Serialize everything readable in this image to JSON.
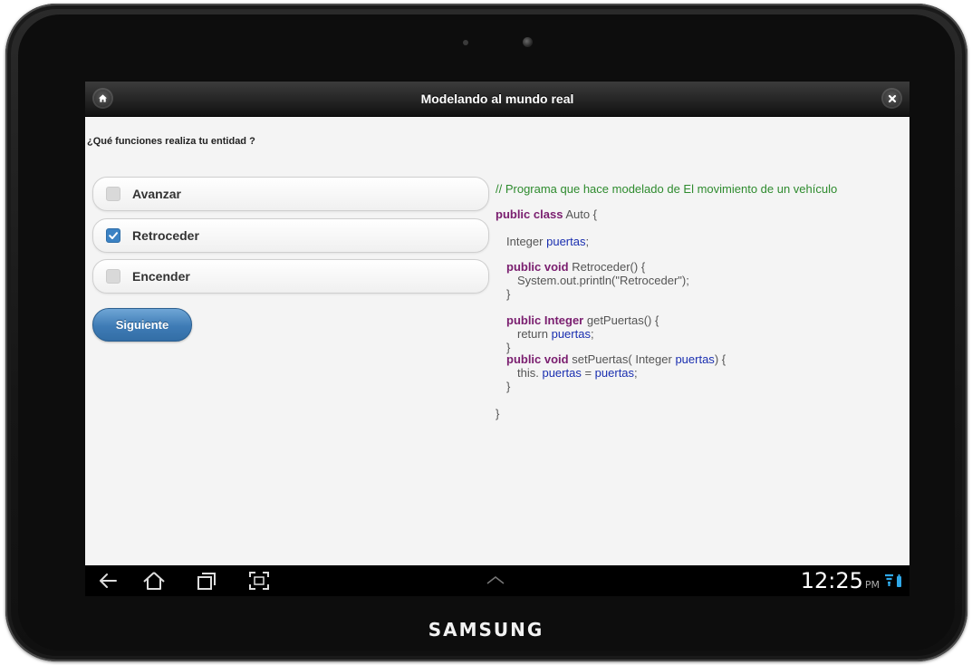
{
  "header": {
    "title": "Modelando al mundo real",
    "home_icon": "home-icon",
    "close_icon": "close-icon"
  },
  "question": "¿Qué funciones realiza tu entidad ?",
  "options": [
    {
      "label": "Avanzar",
      "checked": false
    },
    {
      "label": "Retroceder",
      "checked": true
    },
    {
      "label": "Encender",
      "checked": false
    }
  ],
  "next_button": "Siguiente",
  "code": {
    "comment": "// Programa que hace modelado de El movimiento de un vehículo",
    "class_kw": "public class",
    "class_name": "Auto  {",
    "field_type": "Integer",
    "field_name": "puertas",
    "field_end": ";",
    "m1_kw": "public void",
    "m1_name": "Retroceder() {",
    "m1_body": "System.out.println(\"Retroceder\");",
    "close_brace": "}",
    "m2_kw": "public Integer",
    "m2_name": "getPuertas() {",
    "m2_return": "return",
    "m2_var": "puertas",
    "m2_end": ";",
    "m3_kw": "public void",
    "m3_name": "setPuertas( Integer",
    "m3_param": "puertas",
    "m3_name_end": ") {",
    "m3_this": "this.",
    "m3_lhs": "puertas",
    "m3_eq": " = ",
    "m3_rhs": "puertas",
    "m3_end": ";",
    "class_close": "}"
  },
  "status": {
    "time": "12:25",
    "ampm": "PM"
  },
  "device": {
    "brand": "SAMSUNG"
  },
  "colors": {
    "header_bg": "#111111",
    "button_blue": "#3e7bb5",
    "checkbox_on": "#3b82c4",
    "keyword": "#7a1e6f",
    "variable": "#1a2fb0",
    "comment": "#2e8b2e",
    "status_icon": "#2fa8e8"
  }
}
